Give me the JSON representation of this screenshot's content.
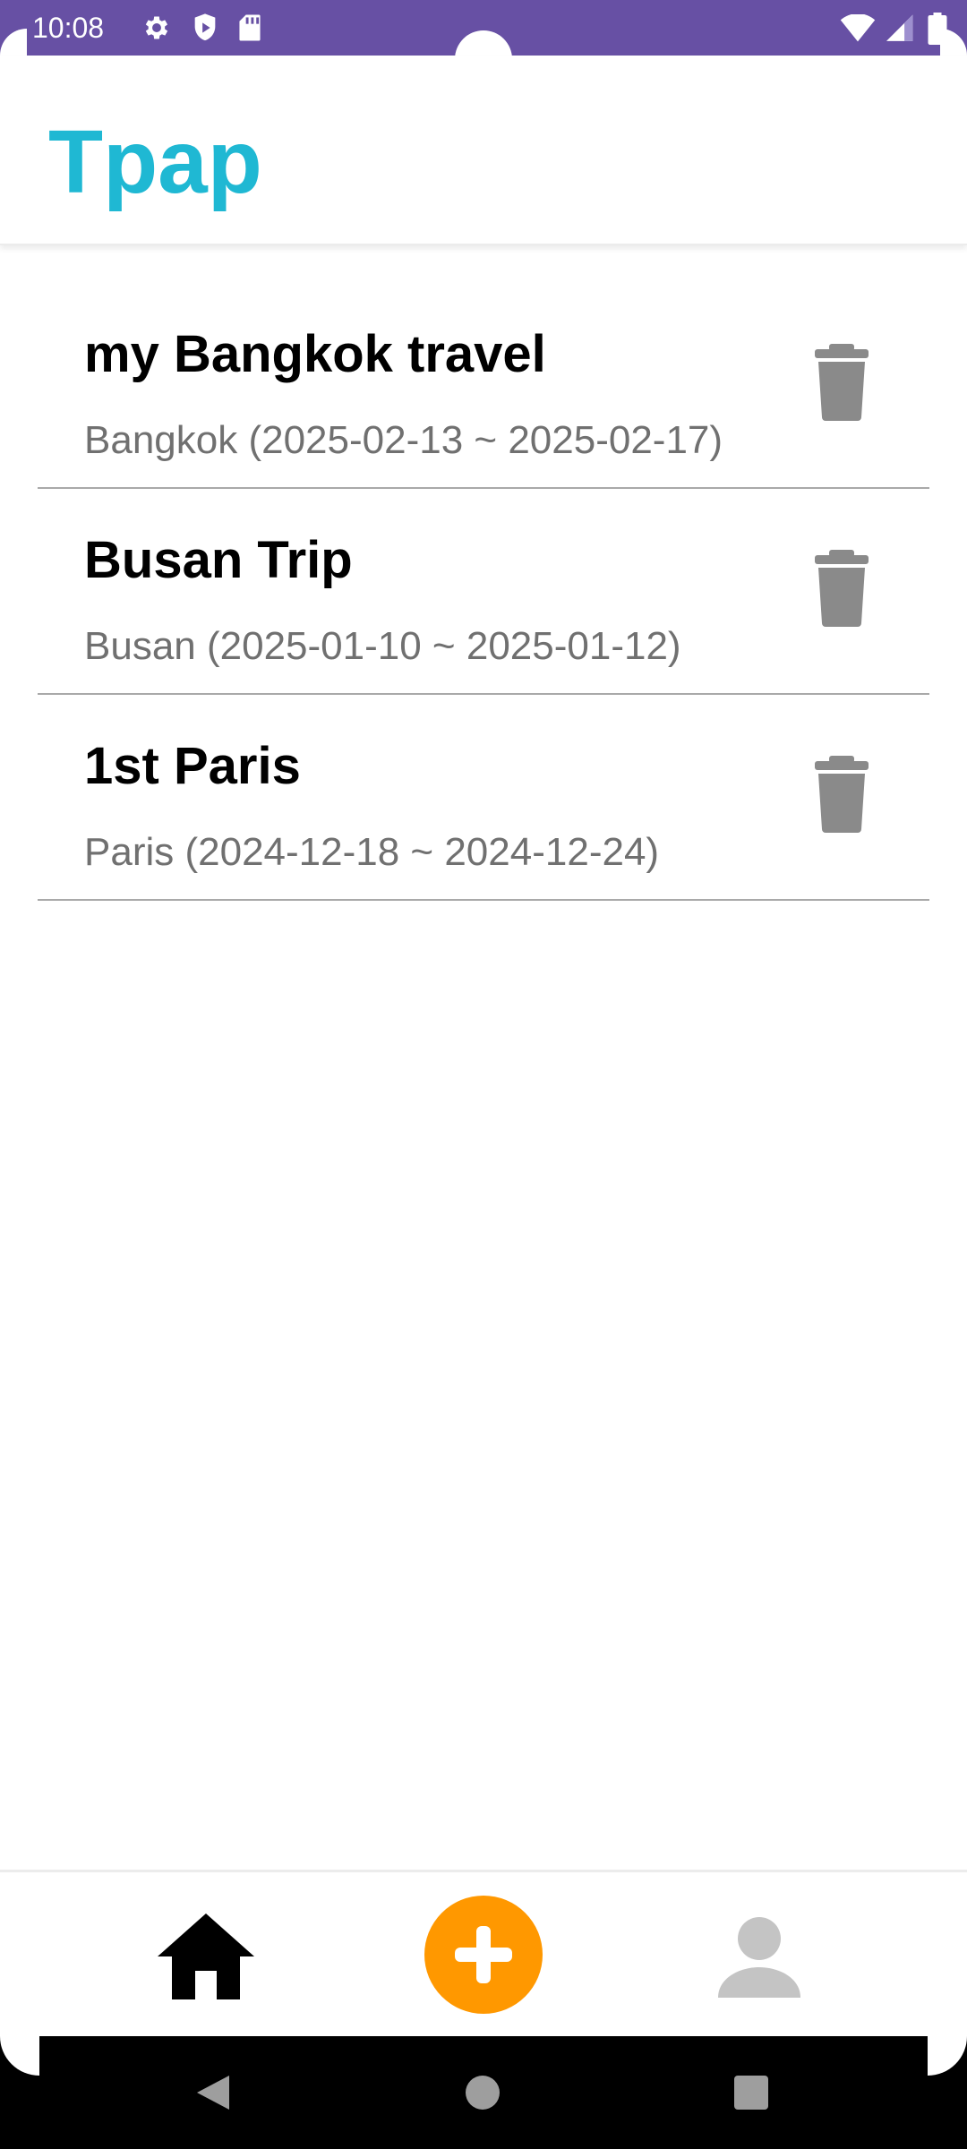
{
  "status_bar": {
    "time": "10:08",
    "background_color": "#6750A4",
    "left_icons": [
      "settings-icon",
      "shield-icon",
      "sd-card-icon"
    ],
    "right_icons": [
      "wifi-icon",
      "signal-icon",
      "battery-icon"
    ]
  },
  "app_bar": {
    "title": "Tpap",
    "title_color": "#1FB8D3"
  },
  "trips": [
    {
      "title": "my Bangkok travel",
      "subtitle": "Bangkok (2025-02-13 ~ 2025-02-17)"
    },
    {
      "title": "Busan Trip",
      "subtitle": "Busan (2025-01-10 ~ 2025-01-12)"
    },
    {
      "title": "1st Paris",
      "subtitle": "Paris (2024-12-18 ~ 2024-12-24)"
    }
  ],
  "bottom_nav": {
    "items": [
      "home-icon",
      "add-icon",
      "profile-icon"
    ],
    "add_button_color": "#FF9800"
  },
  "system_nav": {
    "items": [
      "back-icon",
      "home-circle-icon",
      "recents-icon"
    ]
  }
}
